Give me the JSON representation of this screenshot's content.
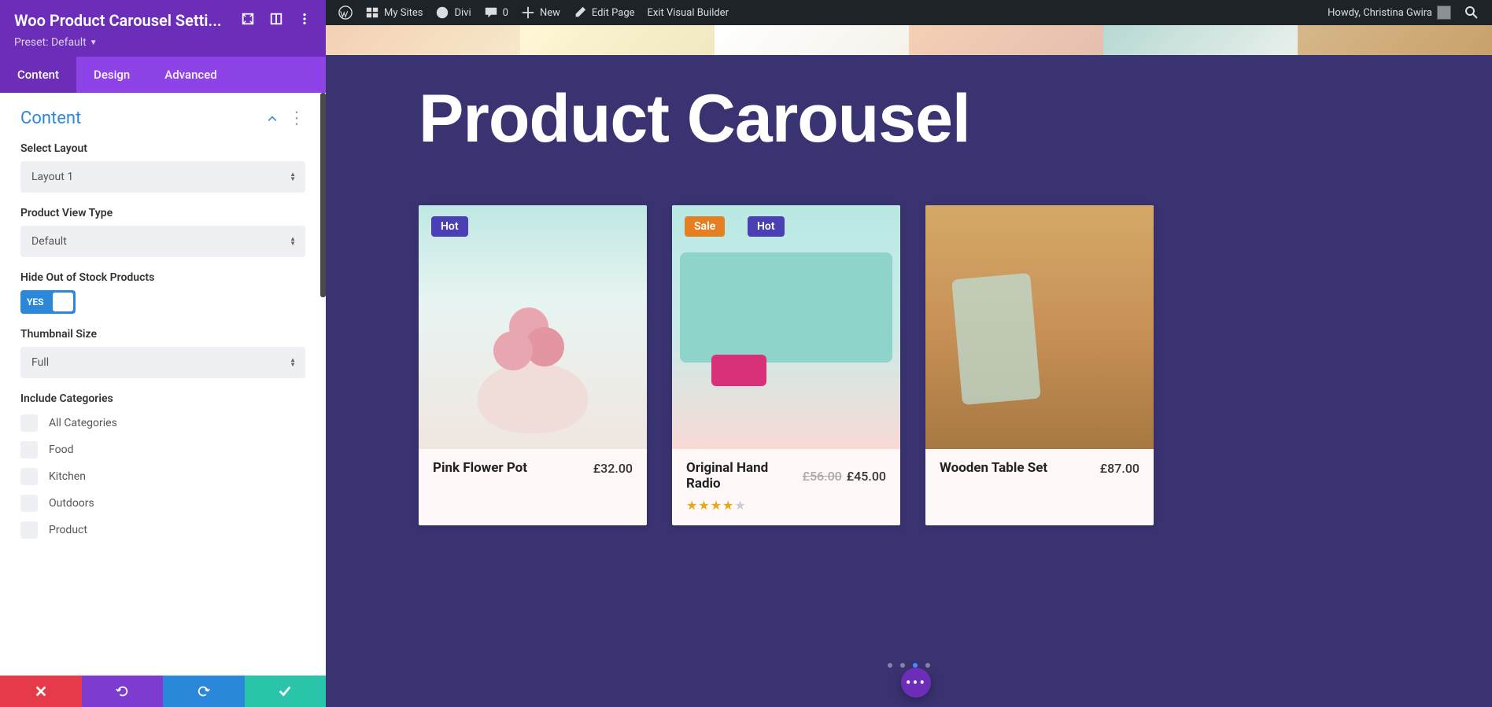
{
  "admin_bar": {
    "my_sites": "My Sites",
    "divi": "Divi",
    "comments": "0",
    "new": "New",
    "edit_page": "Edit Page",
    "exit_vb": "Exit Visual Builder",
    "howdy": "Howdy, Christina Gwira"
  },
  "panel": {
    "title": "Woo Product Carousel Setti...",
    "preset_label": "Preset: Default",
    "tabs": {
      "content": "Content",
      "design": "Design",
      "advanced": "Advanced"
    },
    "section": "Content",
    "fields": {
      "select_layout_label": "Select Layout",
      "select_layout_value": "Layout 1",
      "product_view_label": "Product View Type",
      "product_view_value": "Default",
      "hide_oos_label": "Hide Out of Stock Products",
      "toggle_yes": "YES",
      "thumbnail_label": "Thumbnail Size",
      "thumbnail_value": "Full",
      "include_cat_label": "Include Categories",
      "categories": [
        "All Categories",
        "Food",
        "Kitchen",
        "Outdoors",
        "Product"
      ]
    }
  },
  "hero": {
    "title": "Product Carousel"
  },
  "products": [
    {
      "badges": [
        {
          "text": "Hot",
          "type": "hot"
        }
      ],
      "title": "Pink Flower Pot",
      "price": "£32.00",
      "old_price": "",
      "stars": 0
    },
    {
      "badges": [
        {
          "text": "Sale",
          "type": "sale"
        },
        {
          "text": "Hot",
          "type": "hot2"
        }
      ],
      "title": "Original Hand Radio",
      "price": "£45.00",
      "old_price": "£56.00",
      "stars": 4
    },
    {
      "badges": [],
      "title": "Wooden Table Set",
      "price": "£87.00",
      "old_price": "",
      "stars": 0
    }
  ]
}
